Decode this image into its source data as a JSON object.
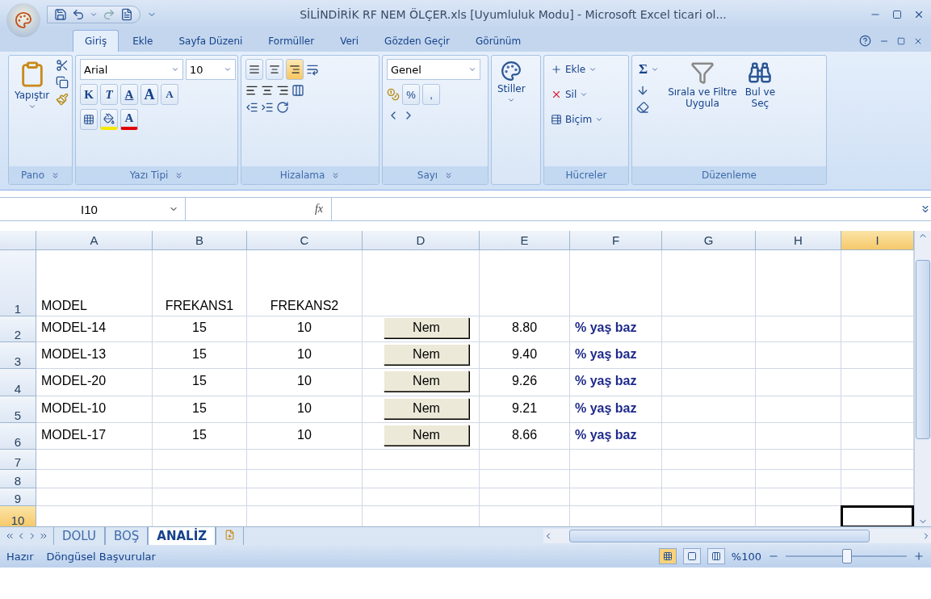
{
  "window": {
    "title": "SİLİNDİRİK RF NEM ÖLÇER.xls  [Uyumluluk Modu] - Microsoft Excel ticari ol..."
  },
  "ribbon_tabs": [
    {
      "label": "Giriş",
      "selected": true
    },
    {
      "label": "Ekle",
      "selected": false
    },
    {
      "label": "Sayfa Düzeni",
      "selected": false
    },
    {
      "label": "Formüller",
      "selected": false
    },
    {
      "label": "Veri",
      "selected": false
    },
    {
      "label": "Gözden Geçir",
      "selected": false
    },
    {
      "label": "Görünüm",
      "selected": false
    }
  ],
  "clipboard": {
    "label": "Pano",
    "paste": "Yapıştır"
  },
  "font": {
    "label": "Yazı Tipi",
    "name": "Arial",
    "size": "10",
    "bold": "K",
    "italic": "T",
    "underline": "A",
    "grow": "A",
    "shrink": "A",
    "font_color": "A"
  },
  "alignment": {
    "label": "Hizalama",
    "align_buttons": [
      {
        "selected": false
      },
      {
        "selected": false
      },
      {
        "selected": true
      }
    ]
  },
  "number": {
    "label": "Sayı",
    "format": "Genel",
    "percent": "%",
    "comma": ","
  },
  "styles": {
    "label": "Stiller"
  },
  "cells": {
    "label": "Hücreler",
    "items": [
      {
        "kind": "insert",
        "label": "Ekle"
      },
      {
        "kind": "delete",
        "label": "Sil"
      },
      {
        "kind": "format",
        "label": "Biçim"
      }
    ]
  },
  "editing": {
    "label": "Düzenleme",
    "sum": "Σ",
    "sort": "Sırala ve Filtre",
    "sort2": "Uygula",
    "find": "Bul ve",
    "find2": "Seç"
  },
  "formula_bar": {
    "name_box": "I10",
    "fx": "fx"
  },
  "sheet": {
    "columns": [
      {
        "label": "A",
        "selected": false
      },
      {
        "label": "B",
        "selected": false
      },
      {
        "label": "C",
        "selected": false
      },
      {
        "label": "D",
        "selected": false
      },
      {
        "label": "E",
        "selected": false
      },
      {
        "label": "F",
        "selected": false
      },
      {
        "label": "G",
        "selected": false
      },
      {
        "label": "H",
        "selected": false
      },
      {
        "label": "I",
        "selected": true
      }
    ],
    "rows": [
      {
        "header": "1",
        "selected": false,
        "model": "MODEL",
        "f1": "FREKANS1",
        "f2": "FREKANS2"
      },
      {
        "header": "2",
        "selected": false,
        "model": "MODEL-14",
        "f1": "15",
        "f2": "10",
        "button": "Nem",
        "value": "8.80",
        "unit": "% yaş baz"
      },
      {
        "header": "3",
        "selected": false,
        "model": "MODEL-13",
        "f1": "15",
        "f2": "10",
        "button": "Nem",
        "value": "9.40",
        "unit": "% yaş baz"
      },
      {
        "header": "4",
        "selected": false,
        "model": "MODEL-20",
        "f1": "15",
        "f2": "10",
        "button": "Nem",
        "value": "9.26",
        "unit": "% yaş baz"
      },
      {
        "header": "5",
        "selected": false,
        "model": "MODEL-10",
        "f1": "15",
        "f2": "10",
        "button": "Nem",
        "value": "9.21",
        "unit": "% yaş baz"
      },
      {
        "header": "6",
        "selected": false,
        "model": "MODEL-17",
        "f1": "15",
        "f2": "10",
        "button": "Nem",
        "value": "8.66",
        "unit": "% yaş baz"
      },
      {
        "header": "7",
        "selected": false
      },
      {
        "header": "8",
        "selected": false
      },
      {
        "header": "9",
        "selected": false
      },
      {
        "header": "10",
        "selected": true
      }
    ]
  },
  "sheet_tabs": [
    {
      "label": "DOLU",
      "selected": false
    },
    {
      "label": "BOŞ",
      "selected": false
    },
    {
      "label": "ANALİZ",
      "selected": true
    }
  ],
  "status_bar": {
    "ready": "Hazır",
    "circular": "Döngüsel Başvurular",
    "views": [
      {
        "selected": true
      },
      {
        "selected": false
      },
      {
        "selected": false
      }
    ],
    "zoom": "%100",
    "zoom_slider": {
      "level": 0.5
    }
  }
}
